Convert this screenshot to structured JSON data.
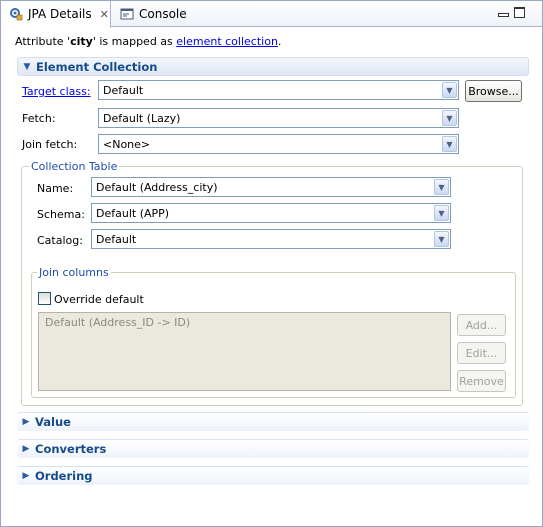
{
  "tabs": [
    {
      "label": "JPA Details",
      "icon": "jpa-details-icon",
      "active": true
    },
    {
      "label": "Console",
      "icon": "console-icon",
      "active": false
    }
  ],
  "info": {
    "prefix": "Attribute '",
    "attribute": "city",
    "middle": "' is mapped as ",
    "link": "element collection",
    "suffix": "."
  },
  "element_collection": {
    "title": "Element Collection",
    "target_class_label": "Target class:",
    "target_class_value": "Default",
    "browse_label": "Browse...",
    "fetch_label": "Fetch:",
    "fetch_value": "Default (Lazy)",
    "join_fetch_label": "Join fetch:",
    "join_fetch_value": "<None>"
  },
  "collection_table": {
    "title": "Collection Table",
    "name_label": "Name:",
    "name_value": "Default (Address_city)",
    "schema_label": "Schema:",
    "schema_value": "Default (APP)",
    "catalog_label": "Catalog:",
    "catalog_value": "Default"
  },
  "join_columns": {
    "title": "Join columns",
    "override_label": "Override default",
    "override_checked": false,
    "list_items": [
      "Default (Address_ID -> ID)"
    ],
    "add_label": "Add...",
    "edit_label": "Edit...",
    "remove_label": "Remove"
  },
  "collapsed_sections": [
    {
      "title": "Value"
    },
    {
      "title": "Converters"
    },
    {
      "title": "Ordering"
    }
  ],
  "colors": {
    "section_title": "#164b8c",
    "link": "#0000ee",
    "group_title": "#1f4ca8"
  }
}
